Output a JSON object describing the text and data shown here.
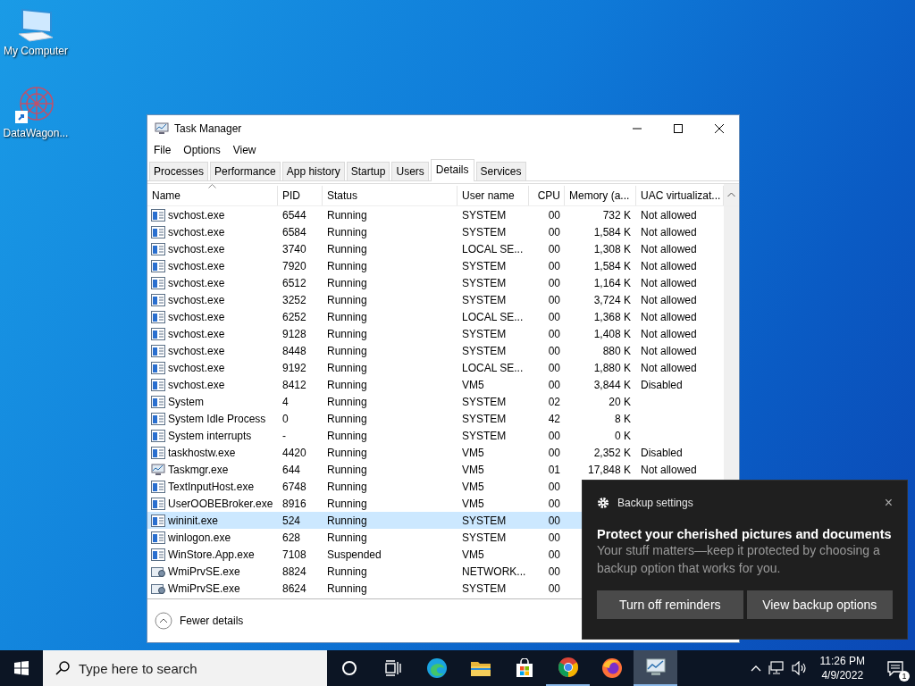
{
  "desktop_icons": [
    {
      "label": "My Computer",
      "kind": "computer"
    },
    {
      "label": "DataWagon...",
      "kind": "shortcut"
    }
  ],
  "window": {
    "title": "Task Manager",
    "menu": [
      "File",
      "Options",
      "View"
    ],
    "tabs": [
      {
        "label": "Processes",
        "selected": false
      },
      {
        "label": "Performance",
        "selected": false
      },
      {
        "label": "App history",
        "selected": false
      },
      {
        "label": "Startup",
        "selected": false
      },
      {
        "label": "Users",
        "selected": false
      },
      {
        "label": "Details",
        "selected": true
      },
      {
        "label": "Services",
        "selected": false
      }
    ],
    "table": {
      "columns": [
        "Name",
        "PID",
        "Status",
        "User name",
        "CPU",
        "Memory (a...",
        "UAC virtualizat..."
      ],
      "rows": [
        {
          "kind": "app",
          "name": "svchost.exe",
          "pid": "6544",
          "status": "Running",
          "user": "SYSTEM",
          "cpu": "00",
          "memory": "732 K",
          "uac": "Not allowed",
          "selected": false
        },
        {
          "kind": "app",
          "name": "svchost.exe",
          "pid": "6584",
          "status": "Running",
          "user": "SYSTEM",
          "cpu": "00",
          "memory": "1,584 K",
          "uac": "Not allowed",
          "selected": false
        },
        {
          "kind": "app",
          "name": "svchost.exe",
          "pid": "3740",
          "status": "Running",
          "user": "LOCAL SE...",
          "cpu": "00",
          "memory": "1,308 K",
          "uac": "Not allowed",
          "selected": false
        },
        {
          "kind": "app",
          "name": "svchost.exe",
          "pid": "7920",
          "status": "Running",
          "user": "SYSTEM",
          "cpu": "00",
          "memory": "1,584 K",
          "uac": "Not allowed",
          "selected": false
        },
        {
          "kind": "app",
          "name": "svchost.exe",
          "pid": "6512",
          "status": "Running",
          "user": "SYSTEM",
          "cpu": "00",
          "memory": "1,164 K",
          "uac": "Not allowed",
          "selected": false
        },
        {
          "kind": "app",
          "name": "svchost.exe",
          "pid": "3252",
          "status": "Running",
          "user": "SYSTEM",
          "cpu": "00",
          "memory": "3,724 K",
          "uac": "Not allowed",
          "selected": false
        },
        {
          "kind": "app",
          "name": "svchost.exe",
          "pid": "6252",
          "status": "Running",
          "user": "LOCAL SE...",
          "cpu": "00",
          "memory": "1,368 K",
          "uac": "Not allowed",
          "selected": false
        },
        {
          "kind": "app",
          "name": "svchost.exe",
          "pid": "9128",
          "status": "Running",
          "user": "SYSTEM",
          "cpu": "00",
          "memory": "1,408 K",
          "uac": "Not allowed",
          "selected": false
        },
        {
          "kind": "app",
          "name": "svchost.exe",
          "pid": "8448",
          "status": "Running",
          "user": "SYSTEM",
          "cpu": "00",
          "memory": "880 K",
          "uac": "Not allowed",
          "selected": false
        },
        {
          "kind": "app",
          "name": "svchost.exe",
          "pid": "9192",
          "status": "Running",
          "user": "LOCAL SE...",
          "cpu": "00",
          "memory": "1,880 K",
          "uac": "Not allowed",
          "selected": false
        },
        {
          "kind": "app",
          "name": "svchost.exe",
          "pid": "8412",
          "status": "Running",
          "user": "VM5",
          "cpu": "00",
          "memory": "3,844 K",
          "uac": "Disabled",
          "selected": false
        },
        {
          "kind": "app",
          "name": "System",
          "pid": "4",
          "status": "Running",
          "user": "SYSTEM",
          "cpu": "02",
          "memory": "20 K",
          "selected": false
        },
        {
          "kind": "app",
          "name": "System Idle Process",
          "pid": "0",
          "status": "Running",
          "user": "SYSTEM",
          "cpu": "42",
          "memory": "8 K",
          "selected": false
        },
        {
          "kind": "app",
          "name": "System interrupts",
          "pid": "-",
          "status": "Running",
          "user": "SYSTEM",
          "cpu": "00",
          "memory": "0 K",
          "selected": false
        },
        {
          "kind": "app",
          "name": "taskhostw.exe",
          "pid": "4420",
          "status": "Running",
          "user": "VM5",
          "cpu": "00",
          "memory": "2,352 K",
          "uac": "Disabled",
          "selected": false
        },
        {
          "kind": "monitor",
          "name": "Taskmgr.exe",
          "pid": "644",
          "status": "Running",
          "user": "VM5",
          "cpu": "01",
          "memory": "17,848 K",
          "uac": "Not allowed",
          "selected": false
        },
        {
          "kind": "app",
          "name": "TextInputHost.exe",
          "pid": "6748",
          "status": "Running",
          "user": "VM5",
          "cpu": "00",
          "selected": false
        },
        {
          "kind": "app",
          "name": "UserOOBEBroker.exe",
          "pid": "8916",
          "status": "Running",
          "user": "VM5",
          "cpu": "00",
          "selected": false
        },
        {
          "kind": "app",
          "name": "wininit.exe",
          "pid": "524",
          "status": "Running",
          "user": "SYSTEM",
          "cpu": "00",
          "selected": true
        },
        {
          "kind": "app",
          "name": "winlogon.exe",
          "pid": "628",
          "status": "Running",
          "user": "SYSTEM",
          "cpu": "00",
          "selected": false
        },
        {
          "kind": "app",
          "name": "WinStore.App.exe",
          "pid": "7108",
          "status": "Suspended",
          "user": "VM5",
          "cpu": "00",
          "selected": false
        },
        {
          "kind": "service",
          "name": "WmiPrvSE.exe",
          "pid": "8824",
          "status": "Running",
          "user": "NETWORK...",
          "cpu": "00",
          "selected": false
        },
        {
          "kind": "service",
          "name": "WmiPrvSE.exe",
          "pid": "8624",
          "status": "Running",
          "user": "SYSTEM",
          "cpu": "00",
          "selected": false
        }
      ]
    },
    "footer_link": "Fewer details"
  },
  "notification": {
    "app": "Backup settings",
    "close": "×",
    "title": "Protect your cherished pictures and documents",
    "body": "Your stuff matters—keep it protected by choosing a backup option that works for you.",
    "buttons": [
      "Turn off reminders",
      "View backup options"
    ]
  },
  "taskbar": {
    "search_placeholder": "Type here to search",
    "apps": [
      {
        "kind": "cortana",
        "running": false,
        "selected": false
      },
      {
        "kind": "taskview",
        "running": false,
        "selected": false
      },
      {
        "kind": "edge",
        "running": false,
        "selected": false
      },
      {
        "kind": "explorer",
        "running": false,
        "selected": false
      },
      {
        "kind": "store",
        "running": false,
        "selected": false
      },
      {
        "kind": "chrome",
        "running": true,
        "selected": false
      },
      {
        "kind": "firefox",
        "running": false,
        "selected": false
      },
      {
        "kind": "taskmanager",
        "running": true,
        "selected": true
      }
    ],
    "time": "11:26 PM",
    "date": "4/9/2022",
    "notification_count": "1"
  }
}
